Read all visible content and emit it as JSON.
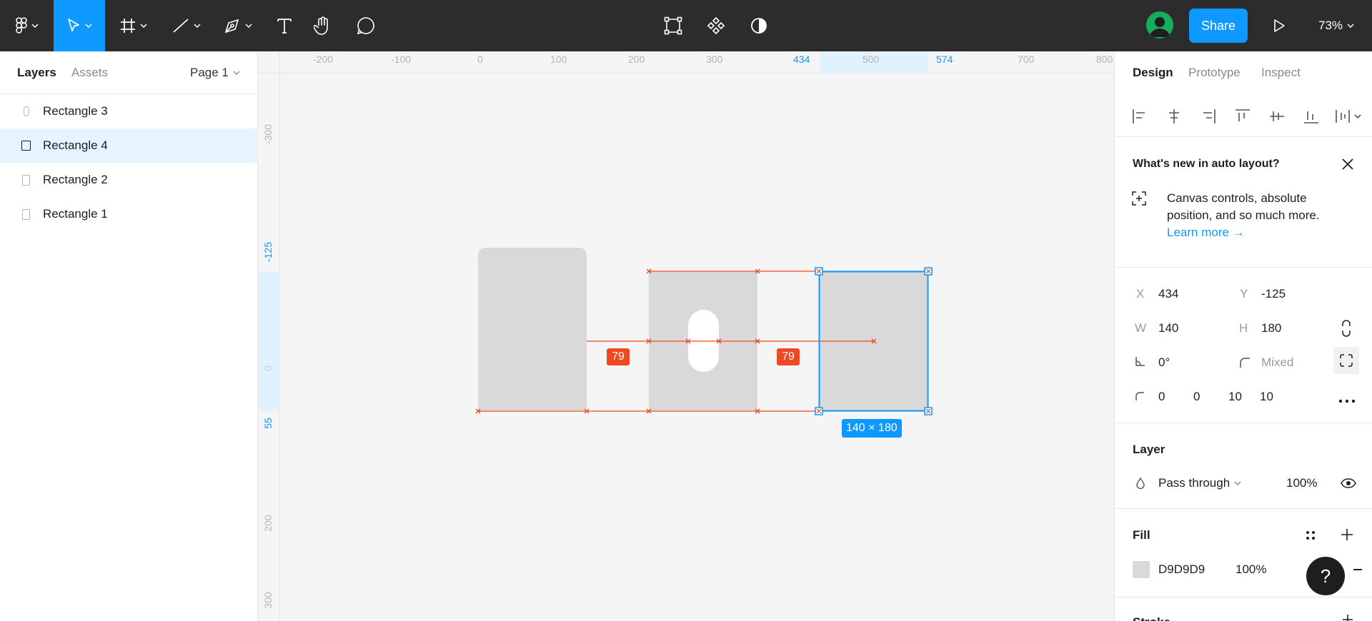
{
  "toolbar": {
    "tools": [
      {
        "name": "main-menu",
        "icon": "figma-logo-icon"
      },
      {
        "name": "move",
        "icon": "cursor-icon",
        "active": true
      },
      {
        "name": "frame",
        "icon": "frame-icon"
      },
      {
        "name": "line",
        "icon": "line-icon"
      },
      {
        "name": "pen",
        "icon": "pen-icon"
      },
      {
        "name": "text",
        "icon": "text-icon"
      },
      {
        "name": "hand",
        "icon": "hand-icon"
      },
      {
        "name": "comment",
        "icon": "comment-icon"
      }
    ],
    "center_tools": [
      "edit-object-icon",
      "component-icon",
      "mask-icon"
    ],
    "share_label": "Share",
    "zoom": "73%",
    "accent_color": "#0d99ff"
  },
  "left_panel": {
    "tabs": [
      "Layers",
      "Assets"
    ],
    "page": "Page 1",
    "layers": [
      {
        "label": "Rectangle 3",
        "selected": false
      },
      {
        "label": "Rectangle 4",
        "selected": true
      },
      {
        "label": "Rectangle 2",
        "selected": false
      },
      {
        "label": "Rectangle 1",
        "selected": false
      }
    ]
  },
  "rulers": {
    "top": [
      "-200",
      "-100",
      "0",
      "100",
      "200",
      "300",
      "434",
      "500",
      "574",
      "700",
      "800"
    ],
    "left": [
      "-300",
      "-125",
      "0",
      "55",
      "200",
      "300"
    ]
  },
  "canvas": {
    "spacing_left": "79",
    "spacing_right": "79",
    "selection_size": "140 × 180",
    "fill_color": "#d9d9d9",
    "measure_color": "#f24822"
  },
  "right_panel": {
    "tabs": [
      "Design",
      "Prototype",
      "Inspect"
    ],
    "announcement": {
      "title": "What's new in auto layout?",
      "body_line1": "Canvas controls, absolute",
      "body_line2": "position, and so much more.",
      "link": "Learn more →"
    },
    "transform": {
      "x_label": "X",
      "x": "434",
      "y_label": "Y",
      "y": "-125",
      "w_label": "W",
      "w": "140",
      "h_label": "H",
      "h": "180",
      "rotation": "0°",
      "radius_placeholder": "Mixed",
      "corners": [
        "0",
        "0",
        "10",
        "10"
      ]
    },
    "layer": {
      "title": "Layer",
      "blend_mode": "Pass through",
      "opacity": "100%"
    },
    "fill": {
      "title": "Fill",
      "hex": "D9D9D9",
      "opacity": "100%"
    },
    "stroke": {
      "title": "Stroke"
    }
  }
}
